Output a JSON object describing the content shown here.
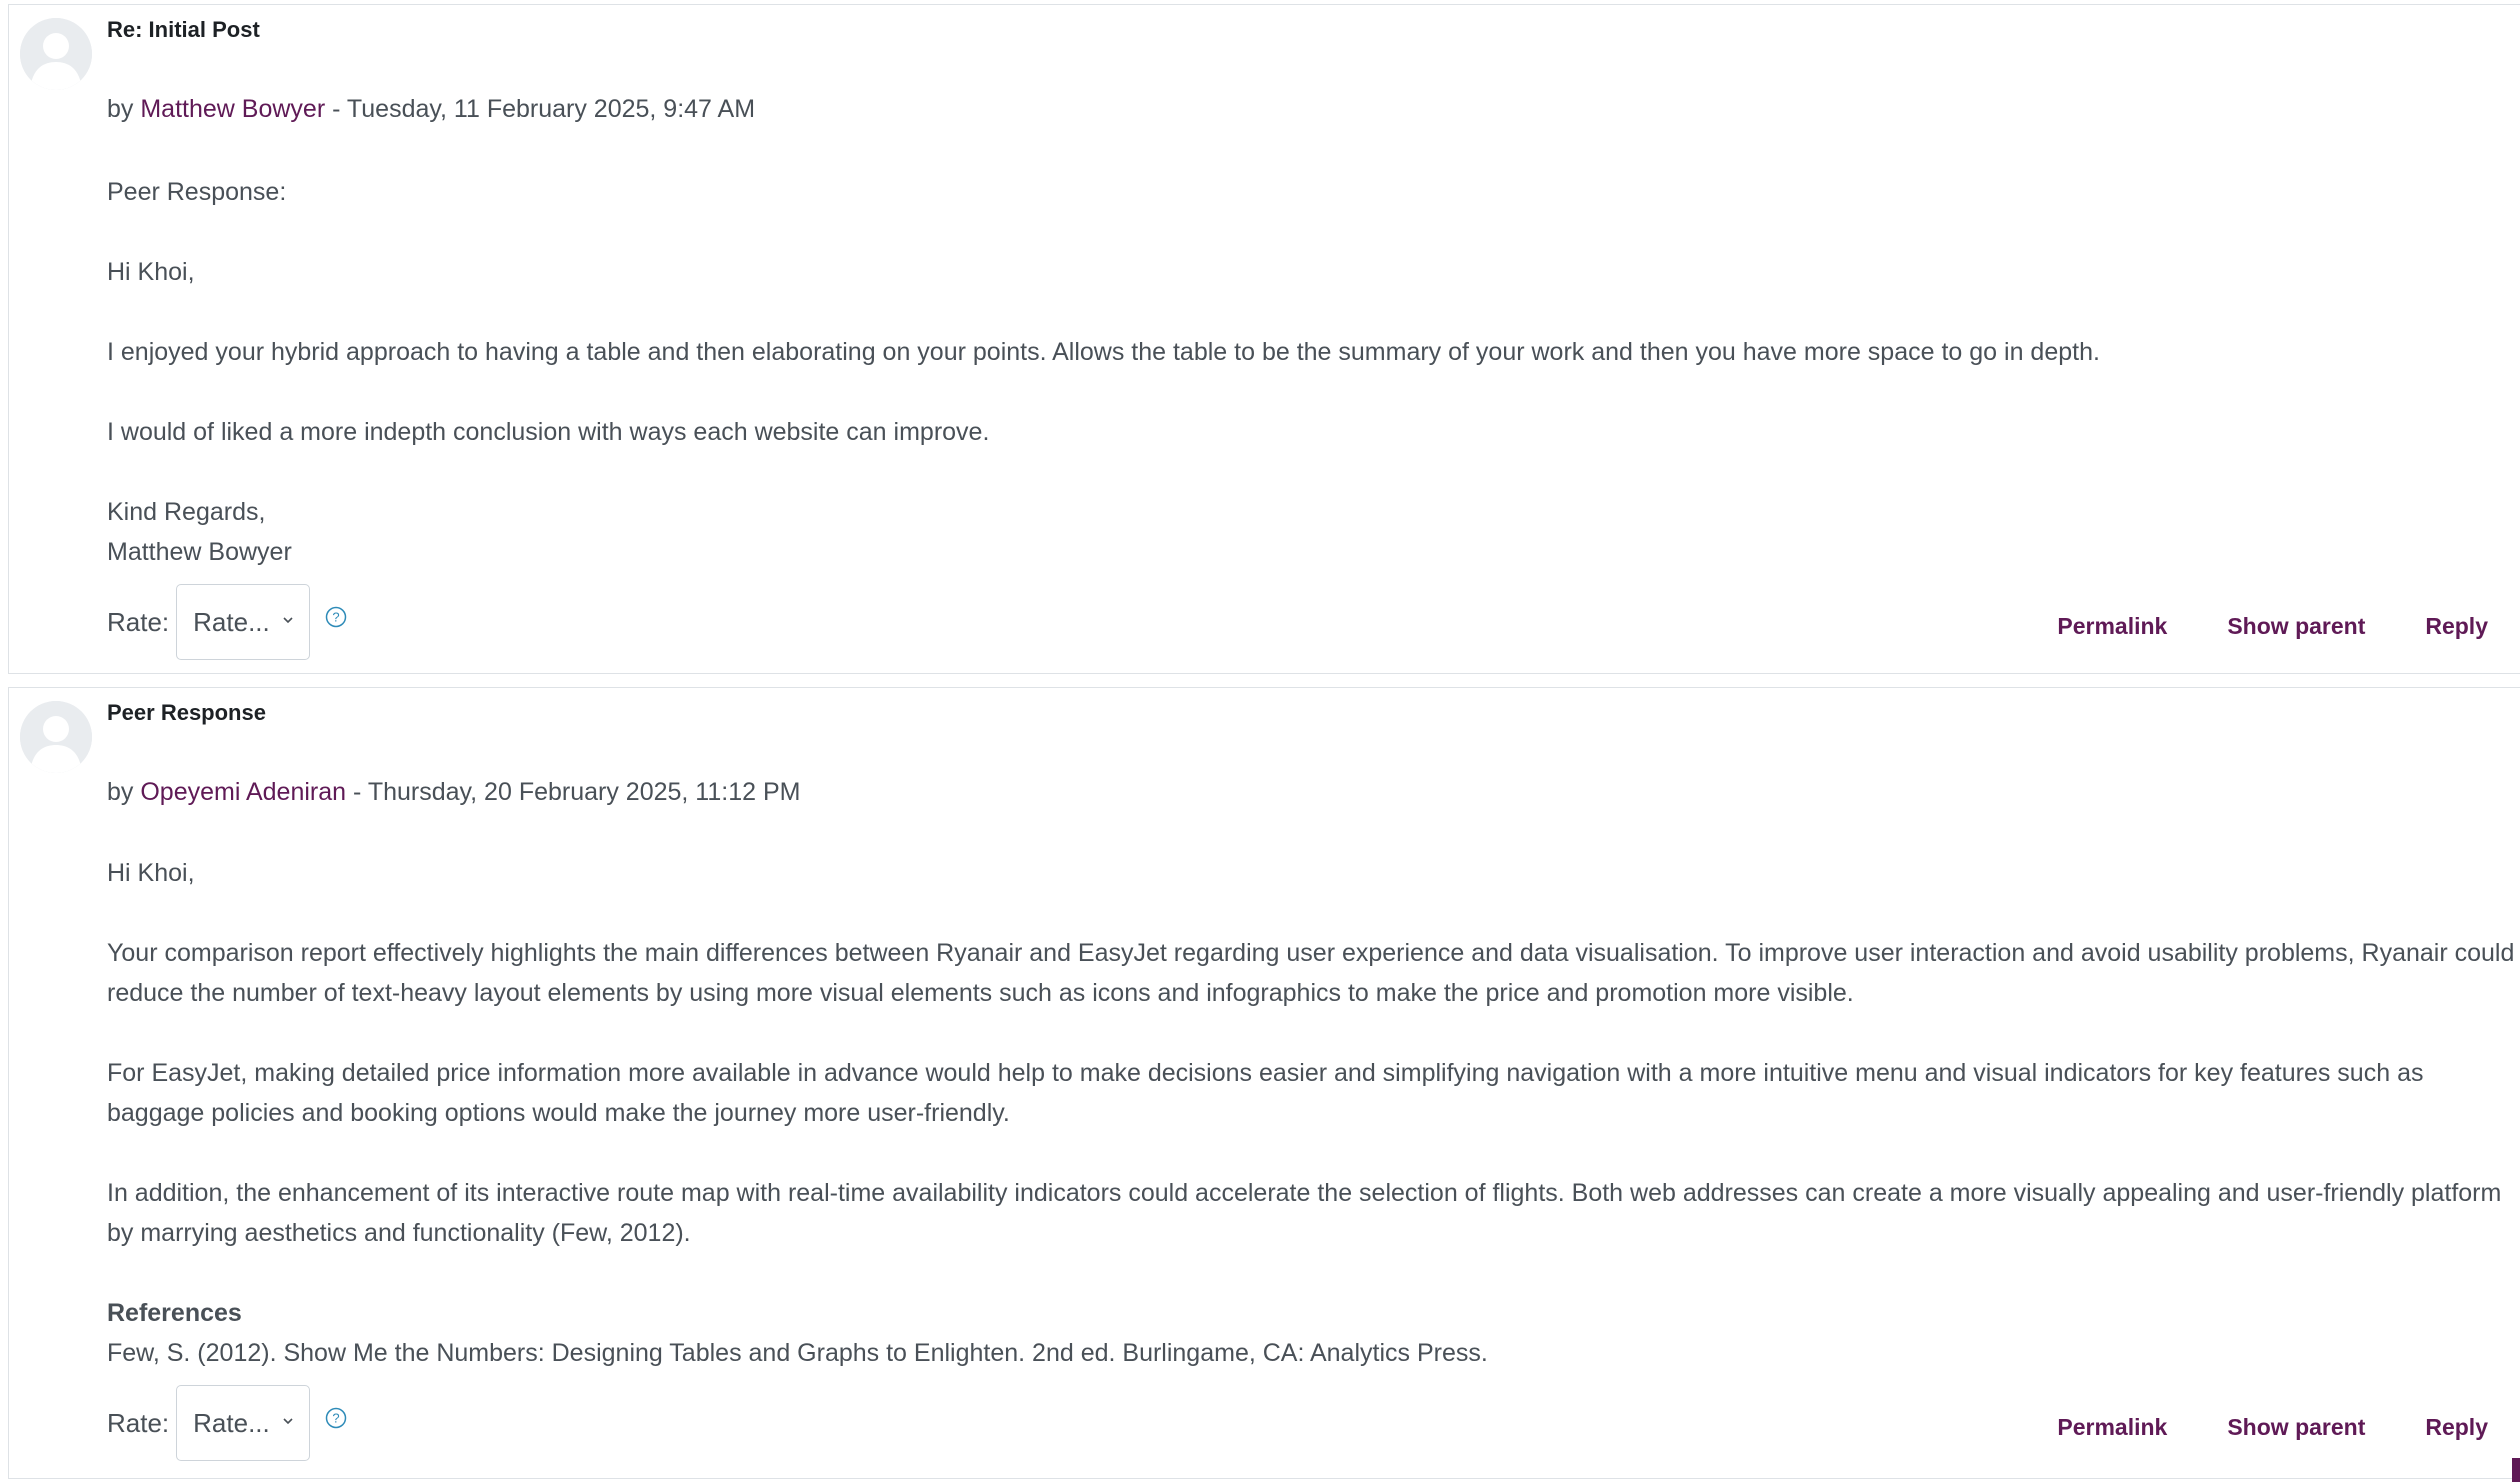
{
  "posts": [
    {
      "subject": "Re: Initial Post",
      "by_prefix": "by ",
      "author": "Matthew Bowyer",
      "date_sep": " - ",
      "date": "Tuesday, 11 February 2025, 9:47 AM",
      "paragraphs": [
        "Peer Response:",
        "Hi Khoi,",
        "I enjoyed your hybrid approach to having a table and then elaborating on your points. Allows the table to be the summary of your work and then you have more space to go in depth.",
        "I would of liked a more indepth conclusion with ways each website can improve."
      ],
      "signoff": [
        "Kind Regards,",
        "Matthew Bowyer"
      ],
      "rate_label": "Rate:",
      "rate_value": "Rate...",
      "help_icon": "question-circle-icon",
      "actions": [
        "Permalink",
        "Show parent",
        "Reply"
      ]
    },
    {
      "subject": "Peer Response",
      "by_prefix": "by ",
      "author": "Opeyemi Adeniran",
      "date_sep": " - ",
      "date": "Thursday, 20 February 2025, 11:12 PM",
      "paragraphs": [
        "Hi Khoi,",
        "Your comparison report effectively highlights the main differences between Ryanair and EasyJet regarding user experience and data visualisation. To improve user interaction and avoid usability problems, Ryanair could reduce the number of text-heavy layout elements by using more visual elements such as icons and infographics to make the price and promotion more visible.",
        "For EasyJet, making detailed price information more available in advance would help to make decisions easier and simplifying navigation with a more intuitive menu and visual indicators for key features such as baggage policies and booking options would make the journey more user-friendly.",
        "In addition, the enhancement of its interactive route map with real-time availability indicators could accelerate the selection of flights. Both web addresses can create a more visually appealing and user-friendly platform by marrying aesthetics and functionality (Few, 2012)."
      ],
      "references_heading": "References",
      "reference": "Few, S. (2012). Show Me the Numbers: Designing Tables and Graphs to Enlighten. 2nd ed. Burlingame, CA: Analytics Press.",
      "rate_label": "Rate:",
      "rate_value": "Rate...",
      "help_icon": "question-circle-icon",
      "actions": [
        "Permalink",
        "Show parent",
        "Reply"
      ]
    }
  ],
  "colors": {
    "link": "#5f1a56",
    "text": "#495057",
    "heading": "#1d2125",
    "help_icon": "#2e8bb8"
  }
}
